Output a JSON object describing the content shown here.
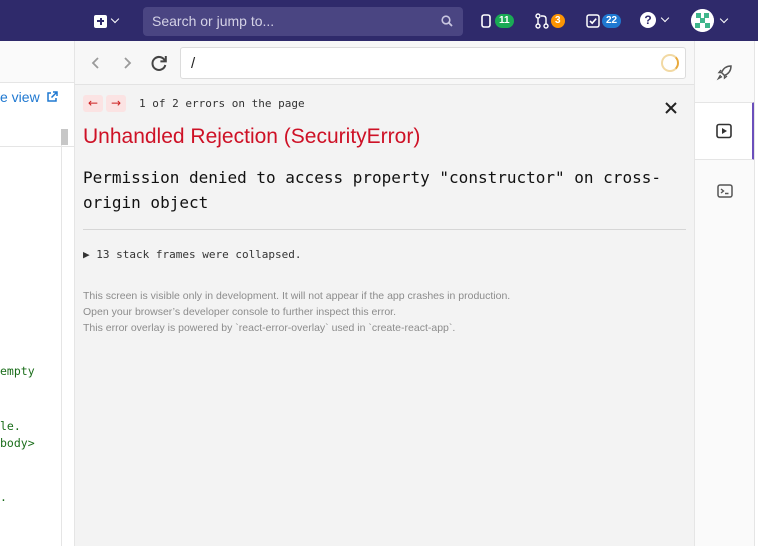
{
  "topbar": {
    "search_placeholder": "Search or jump to...",
    "issues_count": "11",
    "merge_requests_count": "3",
    "todos_count": "22",
    "help_glyph": "?",
    "colors": {
      "bar": "#2f2a6b",
      "issues_badge": "#1aaa55",
      "mr_badge": "#fc9403",
      "todo_badge": "#1f78d1"
    }
  },
  "left_pane": {
    "view_link": "e view",
    "code_lines": [
      "empty",
      "le.",
      "body>",
      "."
    ]
  },
  "preview": {
    "url": "/",
    "overlay": {
      "prev_arrow": "←",
      "next_arrow": "→",
      "error_count": "1 of 2 errors on the page",
      "title": "Unhandled Rejection (SecurityError)",
      "message_line1": "Permission denied to access property \"constructor\" on cross-",
      "message_line2": "origin object",
      "frames": "▶ 13 stack frames were collapsed.",
      "footer": [
        "This screen is visible only in development. It will not appear if the app crashes in production.",
        "Open your browser’s developer console to further inspect this error.",
        "This error overlay is powered by `react-error-overlay` used in `create-react-app`."
      ]
    }
  },
  "right_sidebar": {
    "items": [
      {
        "icon": "rocket-icon"
      },
      {
        "icon": "play-preview-icon",
        "active": true
      },
      {
        "icon": "terminal-icon"
      }
    ],
    "accent": "#6b4fbb"
  }
}
